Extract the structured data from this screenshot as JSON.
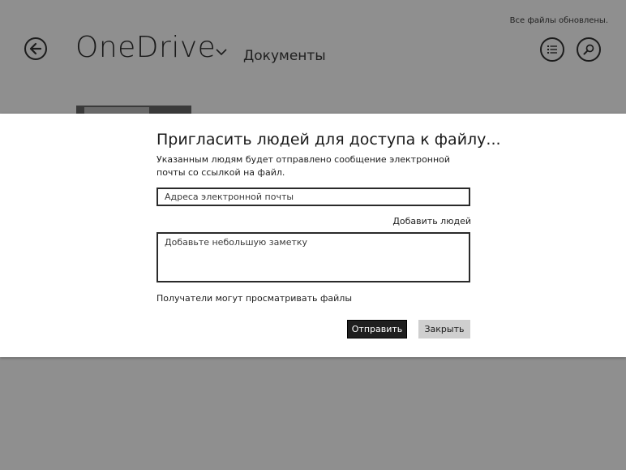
{
  "app": {
    "title": "OneDrive",
    "breadcrumb": "Документы",
    "status": "Все файлы обновлены."
  },
  "icons": {
    "back": "back-arrow-icon",
    "title_menu": "chevron-down-icon",
    "list_view": "list-view-icon",
    "search": "search-icon"
  },
  "dialog": {
    "title": "Пригласить людей для доступа к файлу...",
    "description": "Указанным людям будет отправлено сообщение электронной почты со ссылкой на файл.",
    "email_placeholder": "Адреса электронной почты",
    "add_people": "Добавить людей",
    "note_placeholder": "Добавьте небольшую заметку",
    "permission": "Получатели могут просматривать файлы",
    "send_label": "Отправить",
    "close_label": "Закрыть"
  },
  "colors": {
    "overlay": "#8f8f8f",
    "dialog_bg": "#ffffff",
    "primary_button": "#1f1f1f",
    "secondary_button": "#cfcfcf"
  }
}
